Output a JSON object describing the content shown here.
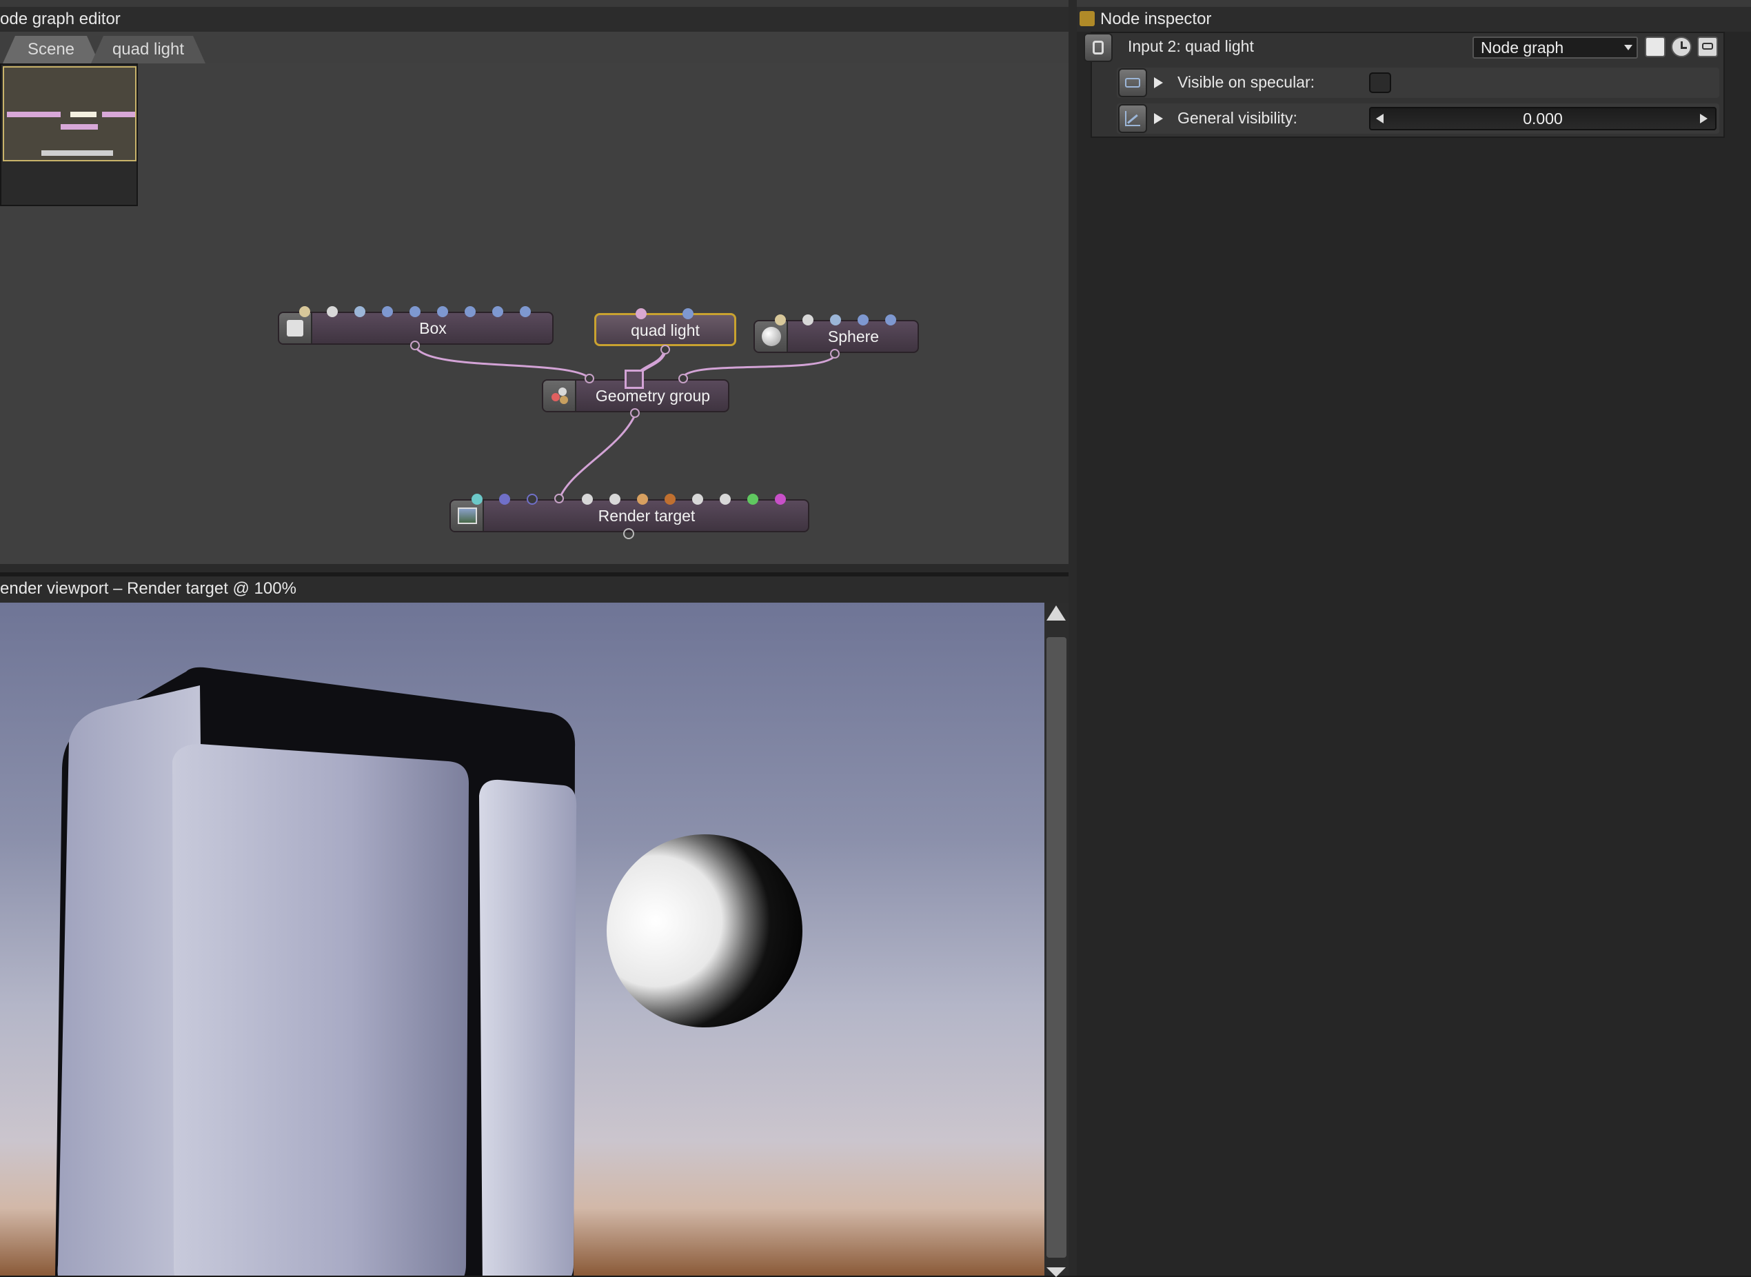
{
  "node_graph_editor": {
    "title": "ode graph editor",
    "tabs": [
      {
        "label": "Scene"
      },
      {
        "label": "quad light"
      }
    ],
    "nodes": {
      "box": {
        "label": "Box",
        "icon": "box-icon"
      },
      "quad_light": {
        "label": "quad light"
      },
      "sphere": {
        "label": "Sphere",
        "icon": "sphere-icon"
      },
      "geometry_group": {
        "label": "Geometry group",
        "icon": "geometry-group-icon"
      },
      "render_target": {
        "label": "Render target",
        "icon": "render-target-icon"
      }
    },
    "colors": {
      "selected_node_border": "#c9a230",
      "wire": "#d3a3d6",
      "minimap_frame": "#c9b36a"
    }
  },
  "render_viewport": {
    "title": "ender viewport – Render target @ 100%"
  },
  "node_inspector": {
    "title": "Node inspector",
    "header": {
      "label": "Input 2: quad light",
      "dropdown_value": "Node graph"
    },
    "properties": [
      {
        "label": "Visible on specular:"
      },
      {
        "label": "General visibility:",
        "value": "0.000"
      }
    ]
  }
}
